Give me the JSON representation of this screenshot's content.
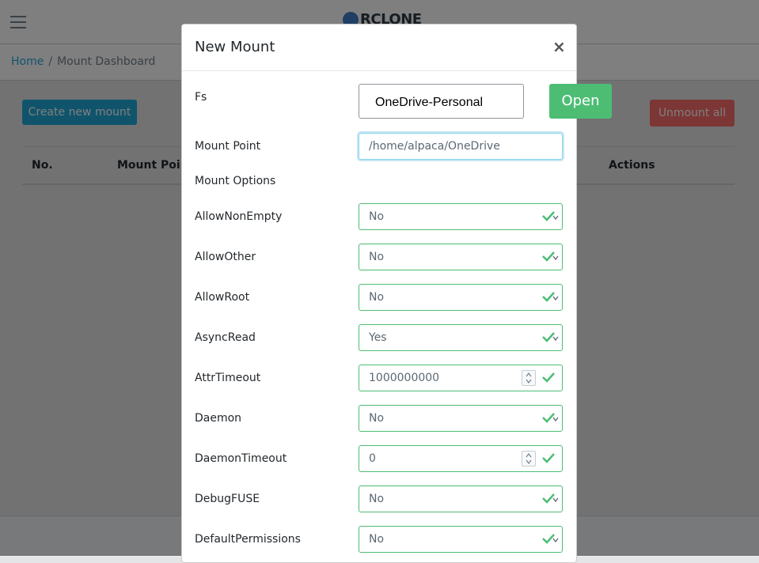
{
  "app": {
    "logo_text": "RCLONE",
    "breadcrumb": {
      "home": "Home",
      "separator": "/",
      "current": "Mount Dashboard"
    },
    "buttons": {
      "create": "Create new mount",
      "unmount_all": "Unmount all"
    },
    "table_headers": [
      "No.",
      "Mount Point",
      "Actions"
    ]
  },
  "modal": {
    "title": "New Mount",
    "close": "×",
    "fs": {
      "label": "Fs",
      "value": "OneDrive-Personal",
      "open_label": "Open"
    },
    "mount_point": {
      "label": "Mount Point",
      "value": "/home/alpaca/OneDrive"
    },
    "options_heading": "Mount Options",
    "options": [
      {
        "label": "AllowNonEmpty",
        "value": "No",
        "kind": "select"
      },
      {
        "label": "AllowOther",
        "value": "No",
        "kind": "select"
      },
      {
        "label": "AllowRoot",
        "value": "No",
        "kind": "select"
      },
      {
        "label": "AsyncRead",
        "value": "Yes",
        "kind": "select"
      },
      {
        "label": "AttrTimeout",
        "value": "1000000000",
        "kind": "number"
      },
      {
        "label": "Daemon",
        "value": "No",
        "kind": "select"
      },
      {
        "label": "DaemonTimeout",
        "value": "0",
        "kind": "number"
      },
      {
        "label": "DebugFUSE",
        "value": "No",
        "kind": "select"
      },
      {
        "label": "DefaultPermissions",
        "value": "No",
        "kind": "select"
      }
    ]
  },
  "colors": {
    "success": "#4dbd74",
    "primary": "#20a8d8",
    "danger": "#f86c6b"
  }
}
